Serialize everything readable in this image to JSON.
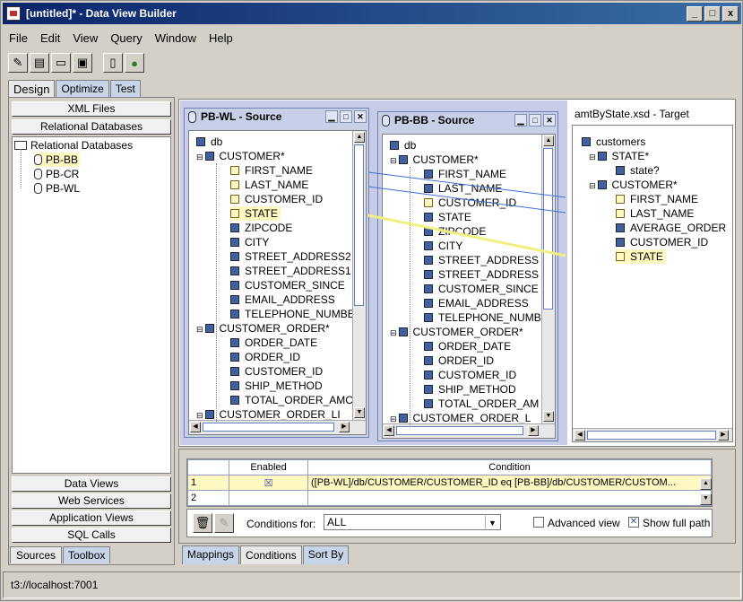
{
  "window": {
    "title": "[untitled]* - Data View Builder",
    "min": "_",
    "max": "□",
    "close": "x"
  },
  "menu": [
    "File",
    "Edit",
    "View",
    "Query",
    "Window",
    "Help"
  ],
  "main_tabs": [
    "Design",
    "Optimize",
    "Test"
  ],
  "left": {
    "top_buttons": [
      "XML Files",
      "Relational Databases"
    ],
    "tree_root": "Relational Databases",
    "tree_items": [
      "PB-BB",
      "PB-CR",
      "PB-WL"
    ],
    "bottom_buttons": [
      "Data Views",
      "Web Services",
      "Application Views",
      "SQL Calls"
    ],
    "tabs": [
      "Sources",
      "Toolbox"
    ]
  },
  "src1": {
    "title": "PB-WL - Source",
    "db": "db",
    "table1": "CUSTOMER*",
    "cols1": [
      "FIRST_NAME",
      "LAST_NAME",
      "CUSTOMER_ID",
      "STATE",
      "ZIPCODE",
      "CITY",
      "STREET_ADDRESS2",
      "STREET_ADDRESS1",
      "CUSTOMER_SINCE",
      "EMAIL_ADDRESS",
      "TELEPHONE_NUMBE"
    ],
    "table2": "CUSTOMER_ORDER*",
    "cols2": [
      "ORDER_DATE",
      "ORDER_ID",
      "CUSTOMER_ID",
      "SHIP_METHOD",
      "TOTAL_ORDER_AMC"
    ],
    "table3": "CUSTOMER_ORDER_LI"
  },
  "src2": {
    "title": "PB-BB - Source",
    "db": "db",
    "table1": "CUSTOMER*",
    "cols1": [
      "FIRST_NAME",
      "LAST_NAME",
      "CUSTOMER_ID",
      "STATE",
      "ZIPCODE",
      "CITY",
      "STREET_ADDRESS",
      "STREET_ADDRESS",
      "CUSTOMER_SINCE",
      "EMAIL_ADDRESS",
      "TELEPHONE_NUMB"
    ],
    "table2": "CUSTOMER_ORDER*",
    "cols2": [
      "ORDER_DATE",
      "ORDER_ID",
      "CUSTOMER_ID",
      "SHIP_METHOD",
      "TOTAL_ORDER_AM"
    ],
    "table3": "CUSTOMER_ORDER_L"
  },
  "target": {
    "title": "amtByState.xsd - Target",
    "root": "customers",
    "n1": "STATE*",
    "n1c": "state?",
    "n2": "CUSTOMER*",
    "n2c": [
      "FIRST_NAME",
      "LAST_NAME",
      "AVERAGE_ORDER",
      "CUSTOMER_ID",
      "STATE"
    ]
  },
  "conditions": {
    "col_enabled": "Enabled",
    "col_condition": "Condition",
    "rows": [
      {
        "n": "1",
        "enabled": "☒",
        "cond": "([PB-WL]/db/CUSTOMER/CUSTOMER_ID  eq  [PB-BB]/db/CUSTOMER/CUSTOM..."
      },
      {
        "n": "2",
        "enabled": "",
        "cond": ""
      }
    ],
    "for_label": "Conditions for:",
    "for_value": "ALL",
    "advanced": "Advanced view",
    "showfull": "Show full path"
  },
  "bottom_tabs": [
    "Mappings",
    "Conditions",
    "Sort By"
  ],
  "status": "t3://localhost:7001",
  "colors": {
    "title_start": "#0a246a",
    "highlight": "#fff8c0",
    "link_line": "#4070d0"
  }
}
